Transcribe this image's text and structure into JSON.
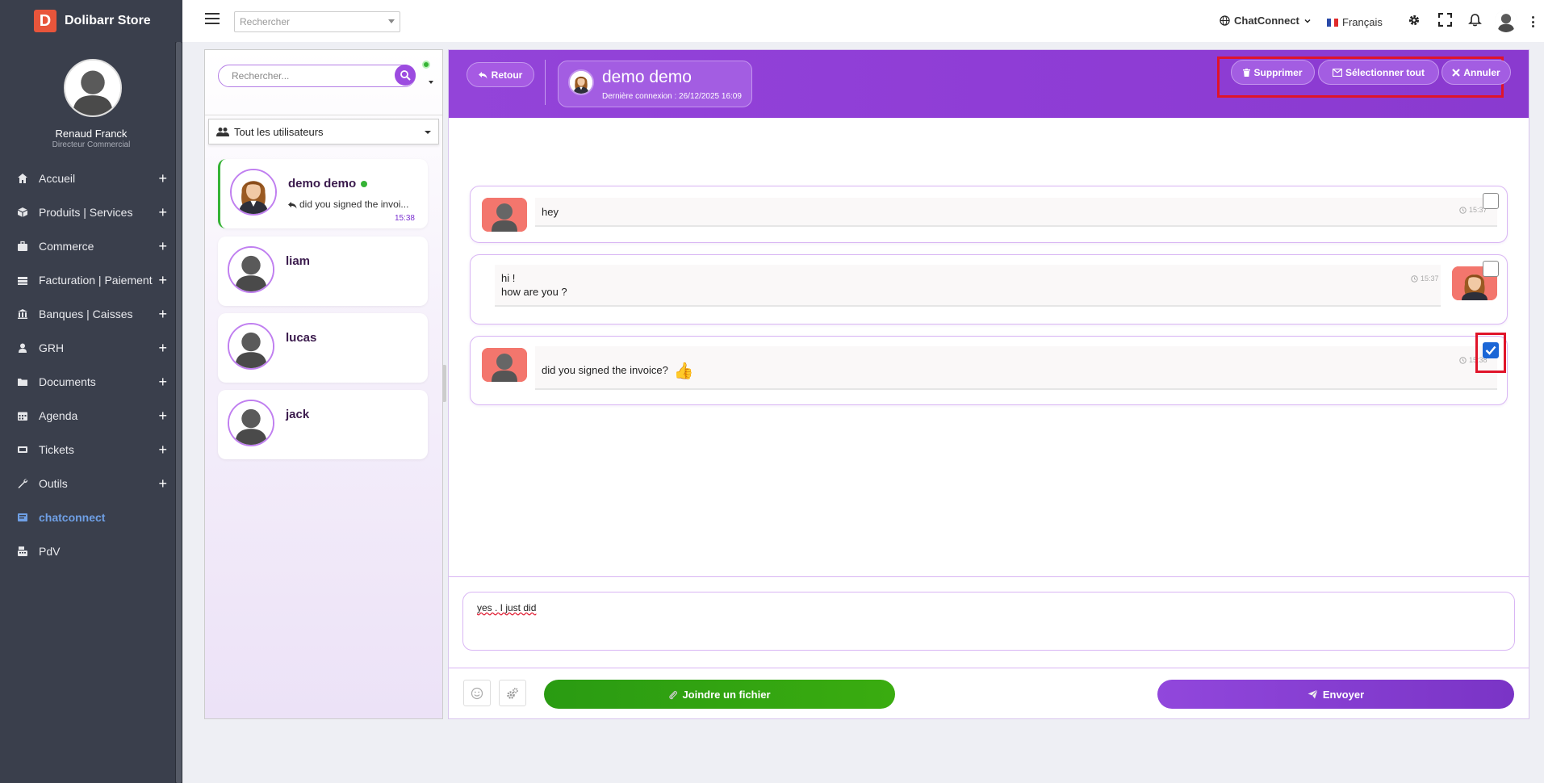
{
  "app": {
    "brand_letter": "D",
    "brand_name": "Dolibarr Store"
  },
  "sidebar": {
    "user_name": "Renaud Franck",
    "user_role": "Directeur Commercial",
    "items": [
      {
        "label": "Accueil",
        "icon": "home-icon",
        "expandable": true
      },
      {
        "label": "Produits | Services",
        "icon": "box-icon",
        "expandable": true
      },
      {
        "label": "Commerce",
        "icon": "briefcase-icon",
        "expandable": true
      },
      {
        "label": "Facturation | Paiement",
        "icon": "money-icon",
        "expandable": true
      },
      {
        "label": "Banques | Caisses",
        "icon": "bank-icon",
        "expandable": true
      },
      {
        "label": "GRH",
        "icon": "user-icon",
        "expandable": true
      },
      {
        "label": "Documents",
        "icon": "folder-icon",
        "expandable": true
      },
      {
        "label": "Agenda",
        "icon": "calendar-icon",
        "expandable": true
      },
      {
        "label": "Tickets",
        "icon": "ticket-icon",
        "expandable": true
      },
      {
        "label": "Outils",
        "icon": "wrench-icon",
        "expandable": true
      },
      {
        "label": "chatconnect",
        "icon": "chat-icon",
        "expandable": false,
        "active": true
      },
      {
        "label": "PdV",
        "icon": "cash-register-icon",
        "expandable": false
      }
    ]
  },
  "topbar": {
    "search_placeholder": "Rechercher",
    "module_menu": "ChatConnect",
    "language": "Français"
  },
  "contacts": {
    "search_placeholder": "Rechercher...",
    "filter_label": "Tout les utilisateurs",
    "list": [
      {
        "name": "demo demo",
        "online": true,
        "last_message": "did you signed the invoi...",
        "time": "15:38",
        "active": true
      },
      {
        "name": "liam",
        "online": false,
        "last_message": "",
        "time": ""
      },
      {
        "name": "lucas",
        "online": false,
        "last_message": "",
        "time": ""
      },
      {
        "name": "jack",
        "online": false,
        "last_message": "",
        "time": ""
      }
    ]
  },
  "chat": {
    "back_label": "Retour",
    "peer_name": "demo demo",
    "peer_last_login": "Dernière connexion : 26/12/2025 16:09",
    "actions": {
      "delete_label": "Supprimer",
      "select_all_label": "Sélectionner tout",
      "cancel_label": "Annuler"
    },
    "messages": [
      {
        "side": "in",
        "text": "hey",
        "time": "15:37",
        "checked": false
      },
      {
        "side": "out",
        "line1": "hi !",
        "line2": "how are you ?",
        "time": "15:37",
        "checked": false
      },
      {
        "side": "in",
        "text": "did you signed the invoice?",
        "emoji": "👍",
        "time": "15:38",
        "checked": true
      }
    ],
    "composer_text": "yes . I just did",
    "attach_label": "Joindre un fichier",
    "send_label": "Envoyer"
  },
  "colors": {
    "sidebar_bg": "#3a3f4c",
    "accent_purple": "#9344d9",
    "attach_green": "#2a9b12",
    "highlight_red": "#e0142a",
    "online_green": "#36b336"
  }
}
